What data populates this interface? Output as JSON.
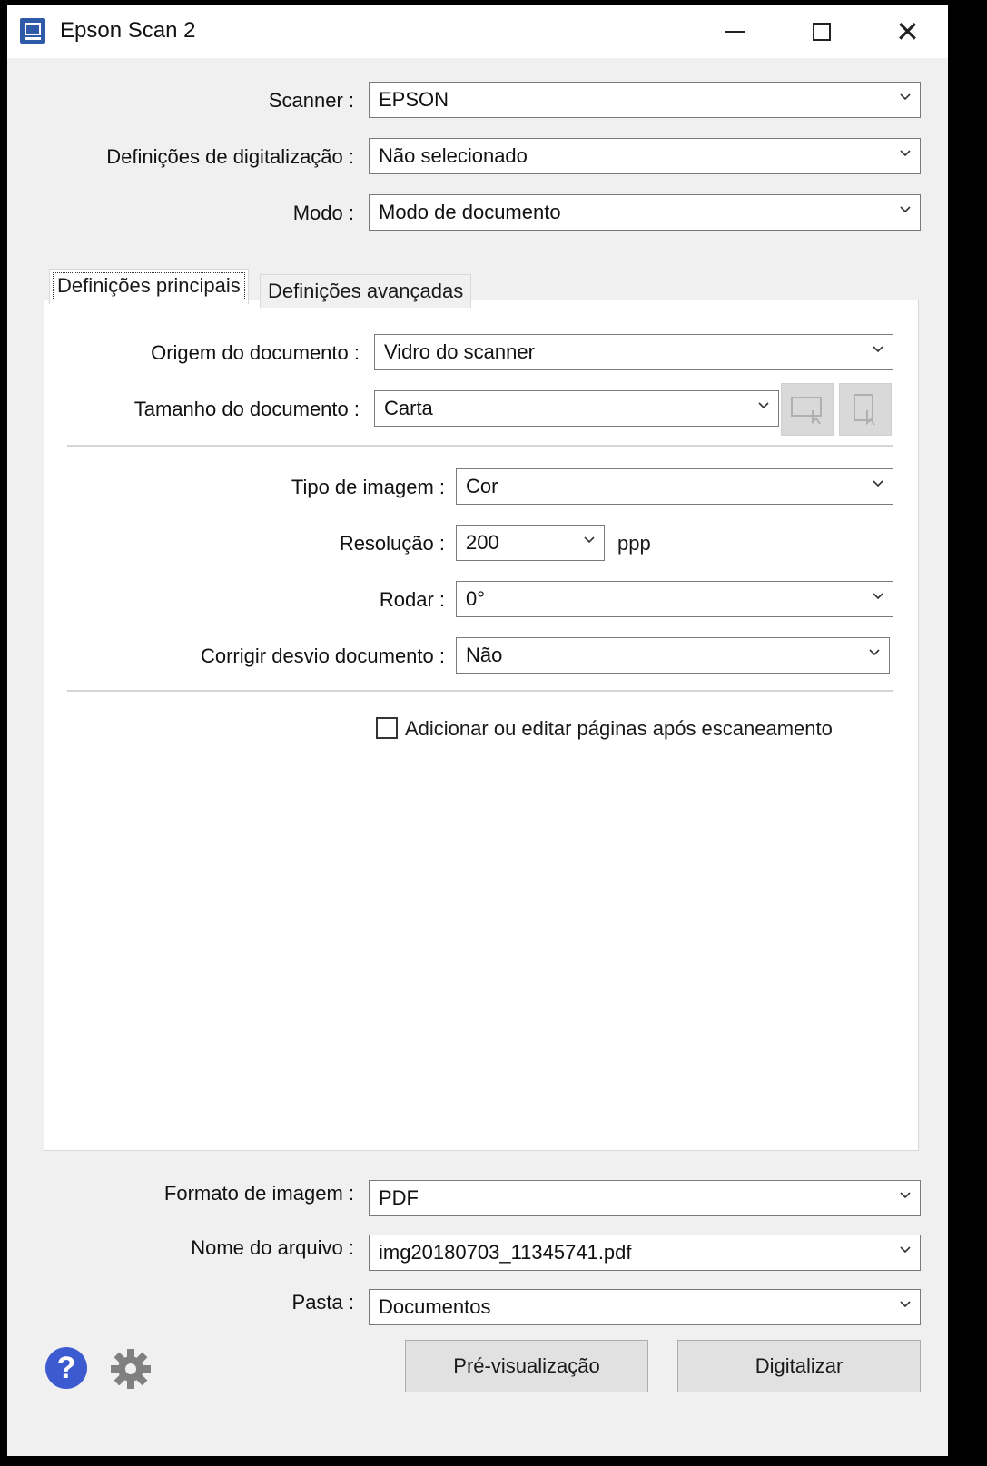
{
  "window": {
    "title": "Epson Scan 2",
    "controls": {
      "minimize": "minimize-icon",
      "maximize": "maximize-icon",
      "close": "close-icon"
    }
  },
  "top_fields": {
    "scanner": {
      "label": "Scanner :",
      "value": "EPSON"
    },
    "scan_settings": {
      "label": "Definições de digitalização :",
      "value": "Não selecionado"
    },
    "mode": {
      "label": "Modo :",
      "value": "Modo de documento"
    }
  },
  "tabs": [
    {
      "label": "Definições principais",
      "active": true
    },
    {
      "label": "Definições avançadas",
      "active": false
    }
  ],
  "main_settings": {
    "document_source": {
      "label": "Origem do documento :",
      "value": "Vidro do scanner"
    },
    "document_size": {
      "label": "Tamanho do documento :",
      "value": "Carta"
    },
    "image_type": {
      "label": "Tipo de imagem :",
      "value": "Cor"
    },
    "resolution": {
      "label": "Resolução :",
      "value": "200",
      "unit": "ppp"
    },
    "rotate": {
      "label": "Rodar :",
      "value": "0°"
    },
    "skew_correction": {
      "label": "Corrigir desvio documento :",
      "value": "Não"
    },
    "add_edit_pages": {
      "label": "Adicionar ou editar páginas após escaneamento",
      "checked": false
    }
  },
  "bottom_fields": {
    "image_format": {
      "label": "Formato de imagem :",
      "value": "PDF"
    },
    "file_name": {
      "label": "Nome do arquivo :",
      "value": "img20180703_11345741.pdf"
    },
    "folder": {
      "label": "Pasta :",
      "value": "Documentos"
    }
  },
  "buttons": {
    "preview": "Pré-visualização",
    "scan": "Digitalizar"
  },
  "help_glyph": "?",
  "colors": {
    "window_bg": "#f0f0f0",
    "panel_bg": "#ffffff",
    "help_blue": "#3c5bd1",
    "button_bg": "#e1e1e1"
  }
}
